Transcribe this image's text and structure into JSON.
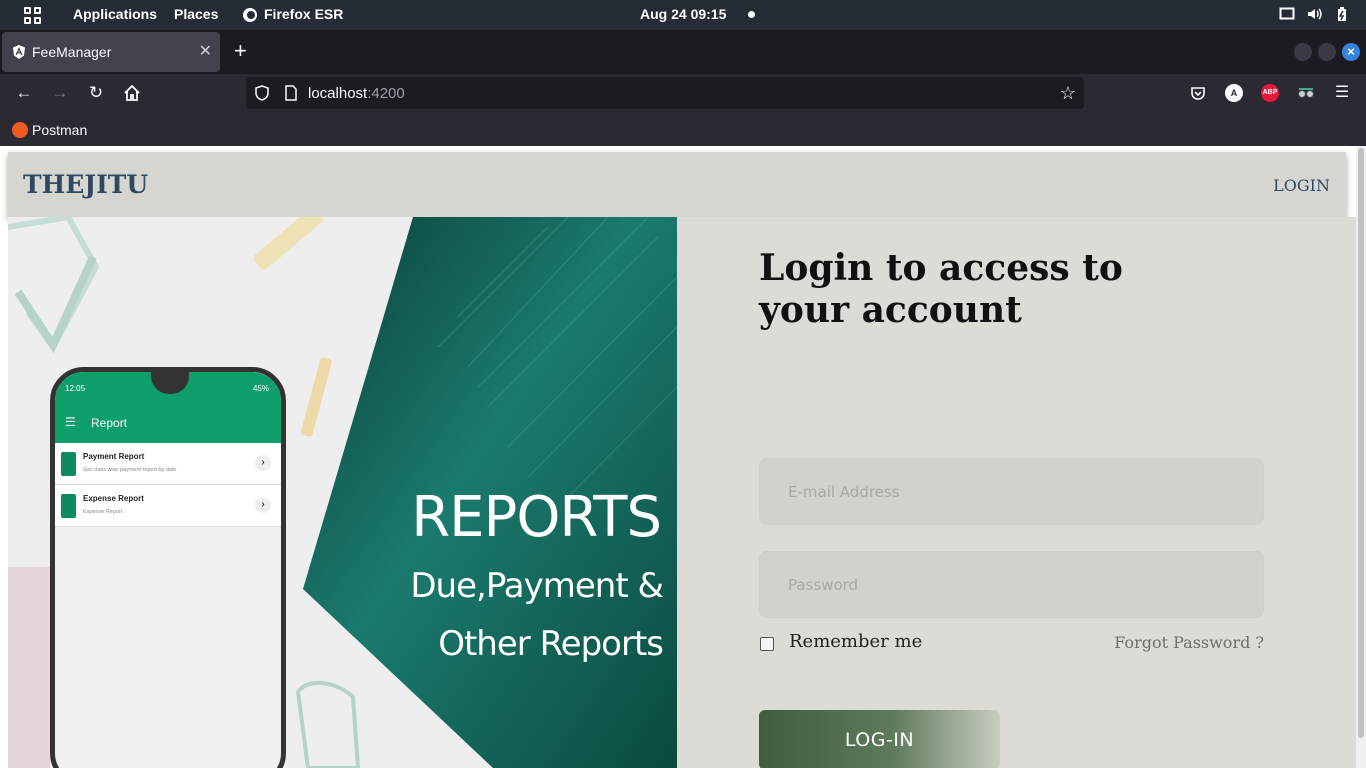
{
  "system_bar": {
    "applications": "Applications",
    "places": "Places",
    "browser": "Firefox ESR",
    "clock": "Aug 24  09:15"
  },
  "browser": {
    "tab_title": "FeeManager",
    "url_host": "localhost",
    "url_port": ":4200",
    "bookmark_postman": "Postman",
    "ext_abp": "ABP",
    "ext_a": "A"
  },
  "app": {
    "brand": "THEJITU",
    "nav_login": "LOGIN"
  },
  "hero": {
    "title": "REPORTS",
    "subtitle": "Due,Payment & Other Reports",
    "phone": {
      "time": "12:05",
      "battery": "45%",
      "screen_title": "Report",
      "items": [
        {
          "title": "Payment Report",
          "subtitle": "Get class wise payment report by date"
        },
        {
          "title": "Expense Report",
          "subtitle": "Expense Report"
        }
      ]
    }
  },
  "login": {
    "heading": "Login to access to your account",
    "email_placeholder": "E-mail Address",
    "password_placeholder": "Password",
    "remember_label": "Remember me",
    "forgot_label": "Forgot Password ?",
    "submit_label": "LOG-IN"
  },
  "colors": {
    "brand_text": "#2e4a63",
    "hero_green": "#0d5a4d",
    "button_green": "#3f5e3f"
  }
}
